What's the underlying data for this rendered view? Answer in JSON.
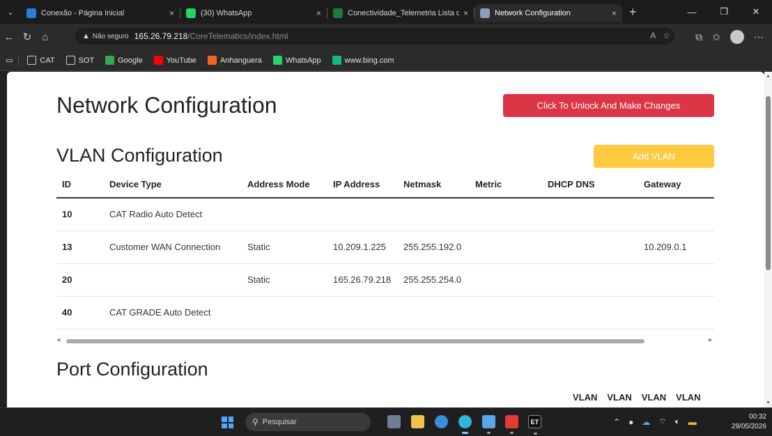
{
  "browser": {
    "tabs": [
      {
        "title": "Conexão - Página Inicial",
        "favicon_color": "#2a7de1",
        "active": false
      },
      {
        "title": "(30) WhatsApp",
        "favicon_color": "#25d366",
        "active": false
      },
      {
        "title": "Conectividade_Telemetria Lista de",
        "favicon_color": "#1f7a3a",
        "active": false
      },
      {
        "title": "Network Configuration",
        "favicon_color": "#8aa0b8",
        "active": true
      }
    ],
    "close_glyph": "×",
    "new_tab_glyph": "+",
    "address": {
      "security_label": "Não seguro",
      "host": "165.26.79.218",
      "path": "/CoreTelematics/index.html"
    },
    "bookmarks": [
      {
        "label": "CAT",
        "icon": "folder-icon",
        "color": "#cfcfcf"
      },
      {
        "label": "SOT",
        "icon": "folder-icon",
        "color": "#cfcfcf"
      },
      {
        "label": "Google",
        "icon": "google-icon",
        "color": "#34a853"
      },
      {
        "label": "YouTube",
        "icon": "youtube-icon",
        "color": "#ff0000"
      },
      {
        "label": "Anhanguera",
        "icon": "anhanguera-icon",
        "color": "#f26522"
      },
      {
        "label": "WhatsApp",
        "icon": "whatsapp-icon",
        "color": "#25d366"
      },
      {
        "label": "www.bing.com",
        "icon": "bing-icon",
        "color": "#12b886"
      }
    ]
  },
  "page": {
    "title": "Network Configuration",
    "unlock_button": "Click To Unlock And Make Changes",
    "vlan_section_title": "VLAN Configuration",
    "add_vlan_button": "Add VLAN",
    "vlan_table": {
      "columns": [
        "ID",
        "Device Type",
        "Address Mode",
        "IP Address",
        "Netmask",
        "Metric",
        "DHCP DNS",
        "Gateway"
      ],
      "rows": [
        [
          "10",
          "CAT Radio Auto Detect",
          "",
          "",
          "",
          "",
          "",
          ""
        ],
        [
          "13",
          "Customer WAN Connection",
          "Static",
          "10.209.1.225",
          "255.255.192.0",
          "",
          "",
          "10.209.0.1"
        ],
        [
          "20",
          "",
          "Static",
          "165.26.79.218",
          "255.255.254.0",
          "",
          "",
          ""
        ],
        [
          "40",
          "CAT GRADE Auto Detect",
          "",
          "",
          "",
          "",
          "",
          ""
        ]
      ]
    },
    "port_section_title": "Port Configuration",
    "port_columns": [
      "VLAN",
      "VLAN",
      "VLAN",
      "VLAN"
    ]
  },
  "taskbar": {
    "search_placeholder": "Pesquisar",
    "time": "00:32",
    "date": "29/05/2026",
    "app_label_et": "ET"
  },
  "colors": {
    "unlock": "#dc3545",
    "add_vlan": "#ffc940"
  }
}
